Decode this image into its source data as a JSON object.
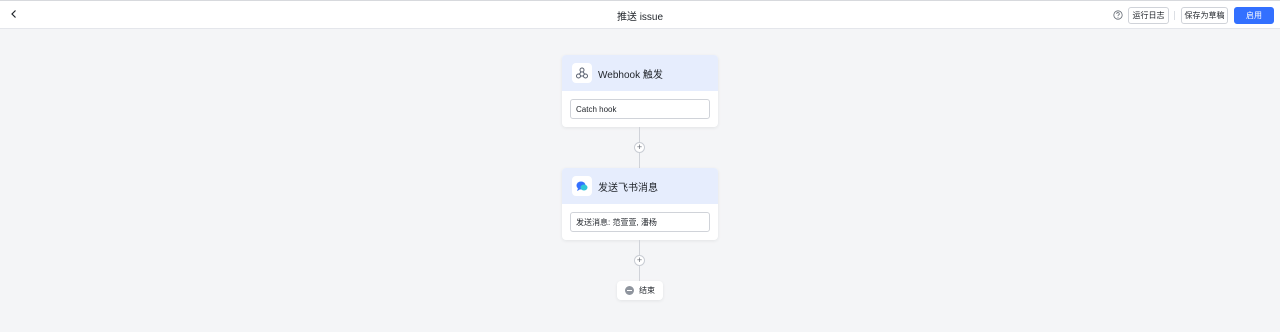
{
  "header": {
    "title": "推送 issue",
    "back_icon": "chevron-left-icon",
    "help_icon": "question-circle-icon",
    "run_log_label": "运行日志",
    "save_draft_label": "保存为草稿",
    "enable_label": "启用",
    "accent_color": "#3370ff"
  },
  "flow": {
    "trigger": {
      "icon": "webhook-icon",
      "title": "Webhook 触发",
      "field": "Catch hook"
    },
    "action": {
      "icon": "feishu-icon",
      "title": "发送飞书消息",
      "field": "发送消息: 范萱萱, 潘杨"
    },
    "add_step_symbol": "+",
    "end": {
      "icon": "stop-icon",
      "label": "结束"
    }
  }
}
